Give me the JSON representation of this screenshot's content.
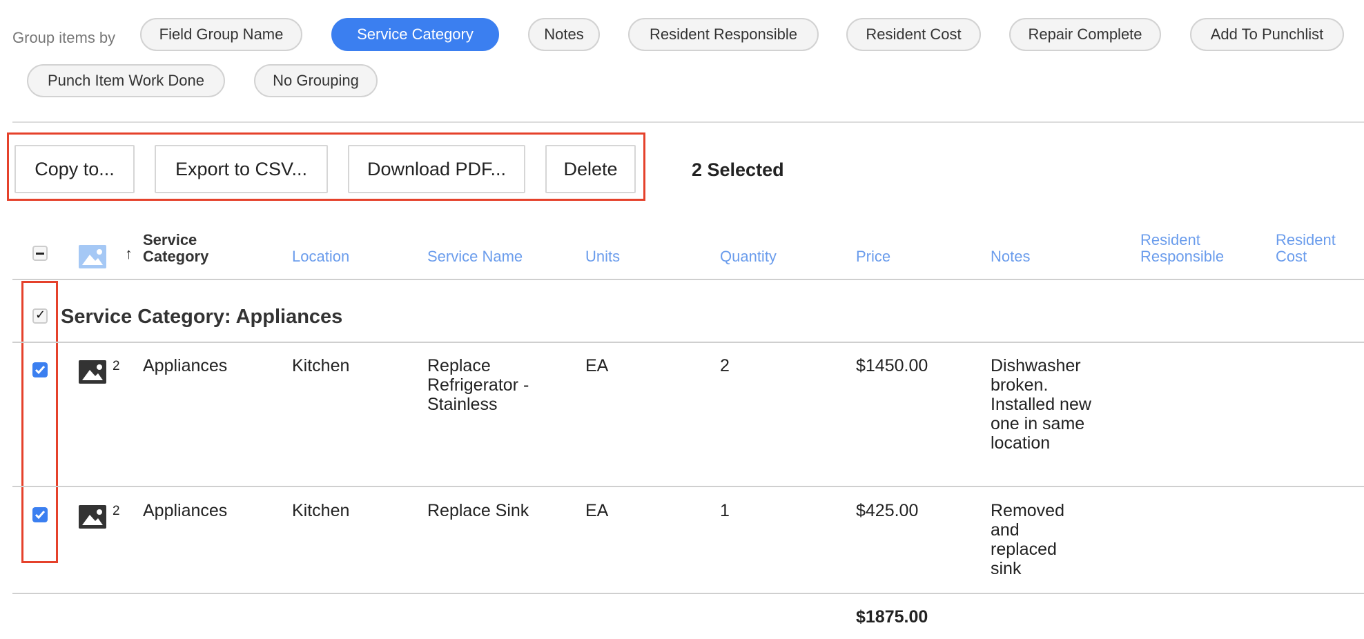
{
  "grouping": {
    "label": "Group items by",
    "options": [
      "Field Group Name",
      "Service Category",
      "Notes",
      "Resident Responsible",
      "Resident Cost",
      "Repair Complete",
      "Add To Punchlist",
      "Punch Item Work Done",
      "No Grouping"
    ],
    "selected": "Service Category"
  },
  "toolbar": {
    "copy_label": "Copy to...",
    "export_label": "Export to CSV...",
    "pdf_label": "Download PDF...",
    "delete_label": "Delete",
    "selected_count": "2 Selected"
  },
  "table": {
    "columns": [
      "Service Category",
      "Location",
      "Service Name",
      "Units",
      "Quantity",
      "Price",
      "Notes",
      "Resident Responsible",
      "Resident Cost"
    ],
    "sort_column": "Service Category",
    "sort_direction": "ascending",
    "group_title": "Service Category: Appliances",
    "rows": [
      {
        "checked": true,
        "photo_count": "2",
        "category": "Appliances",
        "location": "Kitchen",
        "service": "Replace Refrigerator - Stainless",
        "units": "EA",
        "quantity": "2",
        "price": "$1450.00",
        "notes": "Dishwasher broken. Installed new one in same location",
        "resident_responsible": "",
        "resident_cost": ""
      },
      {
        "checked": true,
        "photo_count": "2",
        "category": "Appliances",
        "location": "Kitchen",
        "service": "Replace Sink",
        "units": "EA",
        "quantity": "1",
        "price": "$425.00",
        "notes": "Removed and replaced sink",
        "resident_responsible": "",
        "resident_cost": ""
      }
    ],
    "total": "$1875.00"
  },
  "colors": {
    "accent": "#3b7ff0",
    "highlight": "#e5412b",
    "header_link": "#6a9cec"
  }
}
